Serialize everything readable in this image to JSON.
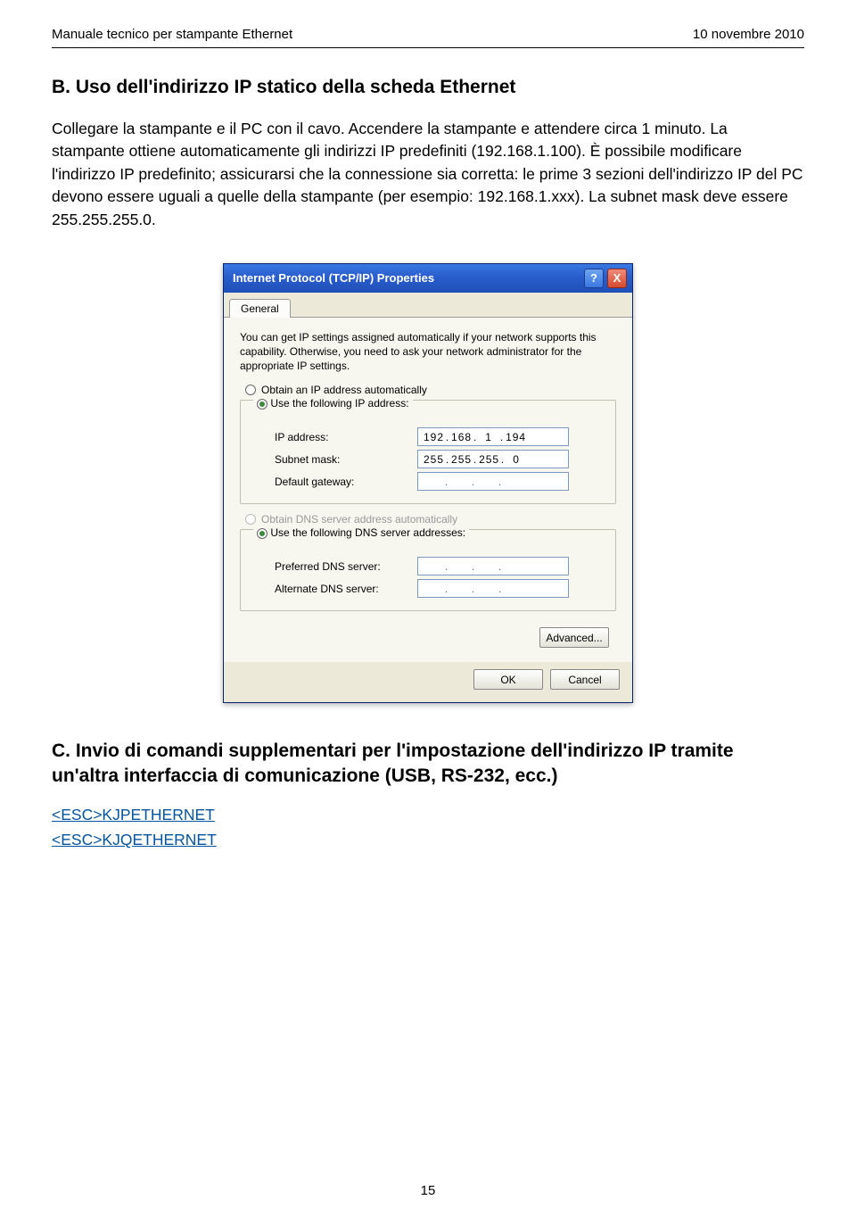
{
  "header": {
    "left": "Manuale tecnico per stampante Ethernet",
    "right": "10 novembre 2010"
  },
  "section_b": {
    "heading": "B. Uso dell'indirizzo IP statico della scheda Ethernet",
    "body": "Collegare la stampante e il PC con il cavo. Accendere la stampante e attendere circa 1 minuto. La stampante ottiene automaticamente gli indirizzi IP predefiniti (192.168.1.100). È possibile modificare l'indirizzo IP predefinito; assicurarsi che la connessione sia corretta: le prime 3 sezioni dell'indirizzo IP del PC devono essere uguali a quelle della stampante (per esempio: 192.168.1.xxx). La subnet mask deve essere 255.255.255.0."
  },
  "dialog": {
    "title": "Internet Protocol (TCP/IP) Properties",
    "help": "?",
    "close": "X",
    "tab": "General",
    "intro": "You can get IP settings assigned automatically if your network supports this capability. Otherwise, you need to ask your network administrator for the appropriate IP settings.",
    "radio_auto_ip": "Obtain an IP address automatically",
    "radio_use_ip": "Use the following IP address:",
    "lbl_ip": "IP address:",
    "lbl_mask": "Subnet mask:",
    "lbl_gw": "Default gateway:",
    "ip": {
      "a": "192",
      "b": "168",
      "c": "1",
      "d": "194"
    },
    "mask": {
      "a": "255",
      "b": "255",
      "c": "255",
      "d": "0"
    },
    "radio_auto_dns": "Obtain DNS server address automatically",
    "radio_use_dns": "Use the following DNS server addresses:",
    "lbl_dns1": "Preferred DNS server:",
    "lbl_dns2": "Alternate DNS server:",
    "btn_adv": "Advanced...",
    "btn_ok": "OK",
    "btn_cancel": "Cancel"
  },
  "section_c": {
    "heading": "C. Invio di comandi supplementari per l'impostazione dell'indirizzo IP tramite un'altra interfaccia di comunicazione (USB, RS-232, ecc.)",
    "esc1": "<ESC>KJPETHERNET",
    "esc2": "<ESC>KJQETHERNET"
  },
  "footer": {
    "page": "15"
  }
}
